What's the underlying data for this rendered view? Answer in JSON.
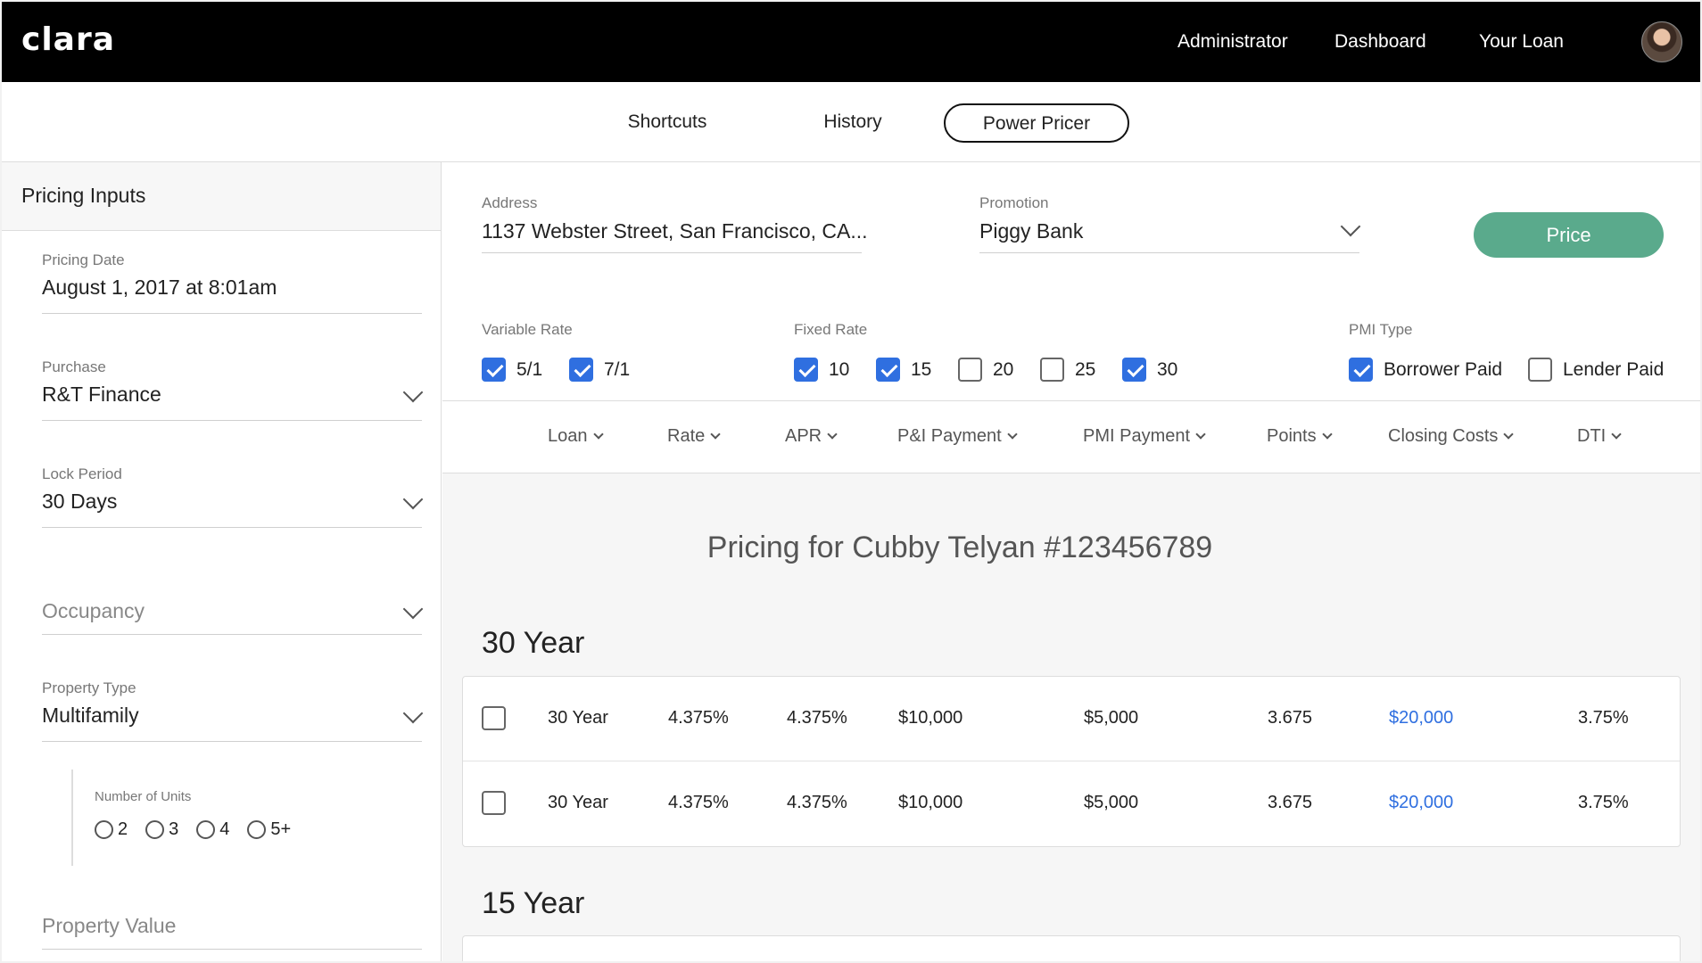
{
  "header": {
    "logo": "clara",
    "nav": [
      "Administrator",
      "Dashboard",
      "Your Loan"
    ]
  },
  "subnav": {
    "tabs": [
      "Shortcuts",
      "History",
      "Power Pricer"
    ],
    "active": "Power Pricer"
  },
  "sidebar": {
    "title": "Pricing Inputs",
    "pricing_date": {
      "label": "Pricing Date",
      "value": "August 1, 2017 at 8:01am"
    },
    "purchase": {
      "label": "Purchase",
      "value": "R&T Finance"
    },
    "lock_period": {
      "label": "Lock Period",
      "value": "30 Days"
    },
    "occupancy": {
      "placeholder": "Occupancy"
    },
    "property_type": {
      "label": "Property Type",
      "value": "Multifamily"
    },
    "units": {
      "label": "Number of Units",
      "options": [
        "2",
        "3",
        "4",
        "5+"
      ]
    },
    "property_value": {
      "placeholder": "Property Value"
    }
  },
  "filters": {
    "address": {
      "label": "Address",
      "value": "1137 Webster Street, San Francisco, CA..."
    },
    "promotion": {
      "label": "Promotion",
      "value": "Piggy Bank"
    },
    "price_button": "Price",
    "variable_rate": {
      "label": "Variable Rate",
      "options": [
        {
          "label": "5/1",
          "checked": true
        },
        {
          "label": "7/1",
          "checked": true
        }
      ]
    },
    "fixed_rate": {
      "label": "Fixed Rate",
      "options": [
        {
          "label": "10",
          "checked": true
        },
        {
          "label": "15",
          "checked": true
        },
        {
          "label": "20",
          "checked": false
        },
        {
          "label": "25",
          "checked": false
        },
        {
          "label": "30",
          "checked": true
        }
      ]
    },
    "pmi_type": {
      "label": "PMI Type",
      "options": [
        {
          "label": "Borrower Paid",
          "checked": true
        },
        {
          "label": "Lender Paid",
          "checked": false
        }
      ]
    }
  },
  "columns": [
    "Loan",
    "Rate",
    "APR",
    "P&I Payment",
    "PMI Payment",
    "Points",
    "Closing Costs",
    "DTI"
  ],
  "pricing_title": "Pricing for Cubby Telyan #123456789",
  "sections": [
    {
      "title": "30 Year",
      "rows": [
        {
          "loan": "30 Year",
          "rate": "4.375%",
          "apr": "4.375%",
          "pi": "$10,000",
          "pmi": "$5,000",
          "points": "3.675",
          "closing": "$20,000",
          "dti": "3.75%"
        },
        {
          "loan": "30 Year",
          "rate": "4.375%",
          "apr": "4.375%",
          "pi": "$10,000",
          "pmi": "$5,000",
          "points": "3.675",
          "closing": "$20,000",
          "dti": "3.75%"
        }
      ]
    },
    {
      "title": "15 Year",
      "rows": []
    }
  ],
  "colors": {
    "accent": "#2f6fe0",
    "price_button": "#5aaa8c",
    "header_bg": "#000000"
  }
}
